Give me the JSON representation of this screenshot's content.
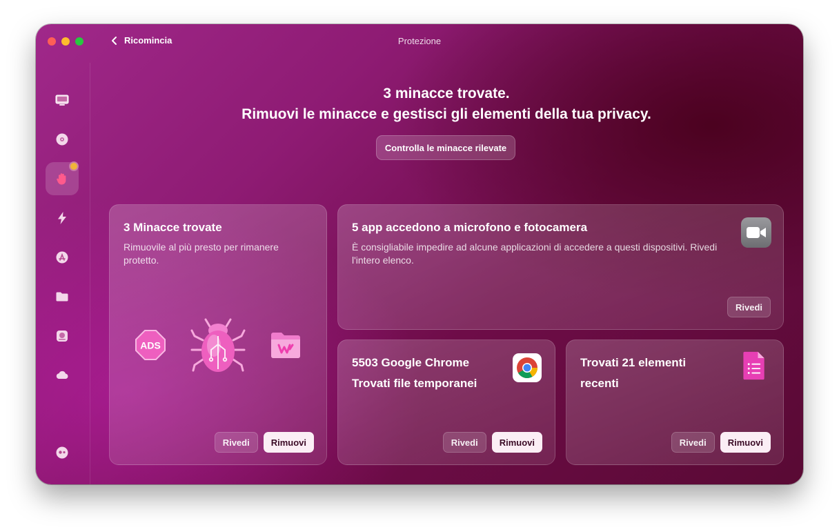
{
  "window": {
    "title": "Protezione",
    "back_label": "Ricomincia"
  },
  "sidebar": {
    "items": [
      {
        "name": "smart-care",
        "icon": "display-icon"
      },
      {
        "name": "cleanup",
        "icon": "disc-icon"
      },
      {
        "name": "protection",
        "icon": "hand-icon",
        "active": true,
        "badge": true
      },
      {
        "name": "performance",
        "icon": "bolt-icon"
      },
      {
        "name": "applications",
        "icon": "app-store-icon"
      },
      {
        "name": "my-clutter",
        "icon": "folder-icon"
      },
      {
        "name": "space-lens",
        "icon": "drive-icon"
      },
      {
        "name": "cloud",
        "icon": "cloud-icon"
      },
      {
        "name": "assistant",
        "icon": "assistant-icon"
      }
    ]
  },
  "header": {
    "line1": "3 minacce trovate.",
    "line2": "Rimuovi le minacce e gestisci gli elementi della tua privacy.",
    "button_label": "Controlla le minacce rilevate"
  },
  "cards": {
    "threats": {
      "title": "3 Minacce trovate",
      "description": "Rimuovile al più presto per rimanere protetto.",
      "icons": [
        "ads-icon",
        "bug-icon",
        "folder-w-icon"
      ],
      "ads_text": "ADS",
      "review_label": "Rivedi",
      "remove_label": "Rimuovi"
    },
    "mic_camera": {
      "title": "5 app accedono a microfono e fotocamera",
      "description": "È consigliabile impedire ad alcune applicazioni di accedere a questi dispositivi. Rivedi l'intero elenco.",
      "icon": "facetime-icon",
      "review_label": "Rivedi"
    },
    "chrome": {
      "title_line1": "5503 Google Chrome",
      "title_line2": "Trovati file temporanei",
      "icon": "chrome-icon",
      "review_label": "Rivedi",
      "remove_label": "Rimuovi"
    },
    "recent": {
      "title_line1": "Trovati 21 elementi",
      "title_line2": "recenti",
      "icon": "document-list-icon",
      "review_label": "Rivedi",
      "remove_label": "Rimuovi"
    }
  },
  "colors": {
    "accent_pink": "#e650b8",
    "badge_yellow": "#f0b43a",
    "primary_button_bg": "#fbeef5"
  }
}
